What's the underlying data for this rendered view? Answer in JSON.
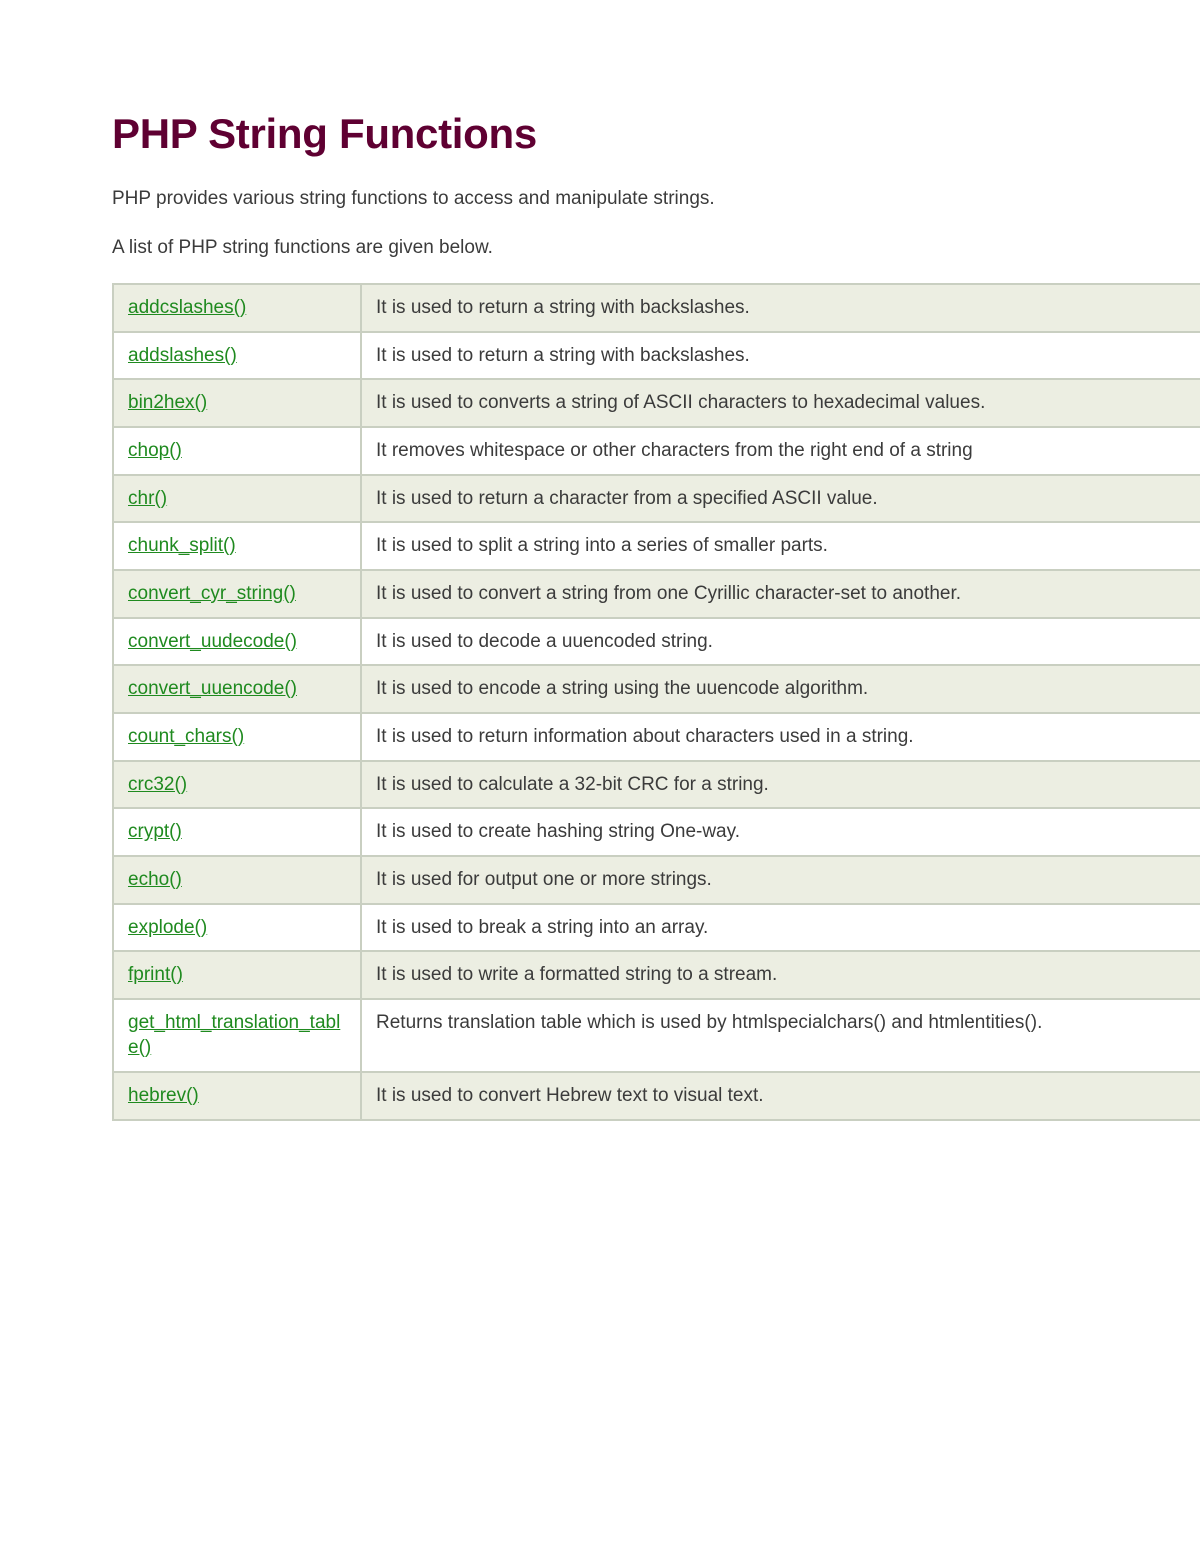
{
  "title": "PHP String Functions",
  "intro1": "PHP provides various string functions to access and manipulate strings.",
  "intro2": "A list of PHP string functions are given below.",
  "rows": [
    {
      "fn": "addcslashes()",
      "desc": "It is used to return a string with backslashes."
    },
    {
      "fn": "addslashes()",
      "desc": "It is used to return a string with backslashes."
    },
    {
      "fn": "bin2hex()",
      "desc": "It is used to converts a string of ASCII characters to hexadecimal values."
    },
    {
      "fn": "chop()",
      "desc": "It removes whitespace or other characters from the right end of a string"
    },
    {
      "fn": "chr()",
      "desc": "It is used to return a character from a specified ASCII value."
    },
    {
      "fn": "chunk_split()",
      "desc": "It is used to split a string into a series of smaller parts."
    },
    {
      "fn": "convert_cyr_string()",
      "desc": "It is used to convert a string from one Cyrillic character-set to another."
    },
    {
      "fn": "convert_uudecode()",
      "desc": "It is used to decode a uuencoded string."
    },
    {
      "fn": "convert_uuencode()",
      "desc": "It is used to encode a string using the uuencode algorithm."
    },
    {
      "fn": "count_chars()",
      "desc": "It is used to return information about characters used in a string."
    },
    {
      "fn": "crc32()",
      "desc": "It is used to calculate a 32-bit CRC for a string."
    },
    {
      "fn": "crypt()",
      "desc": "It is used to create hashing string One-way."
    },
    {
      "fn": "echo()",
      "desc": "It is used for output one or more strings."
    },
    {
      "fn": "explode()",
      "desc": "It is used to break a string into an array."
    },
    {
      "fn": "fprint()",
      "desc": "It is used to write a formatted string to a stream."
    },
    {
      "fn": "get_html_translation_table()",
      "desc": "Returns translation table which is used by htmlspecialchars() and htmlentities()."
    },
    {
      "fn": "hebrev()",
      "desc": "It is used to convert Hebrew text to visual text."
    }
  ]
}
